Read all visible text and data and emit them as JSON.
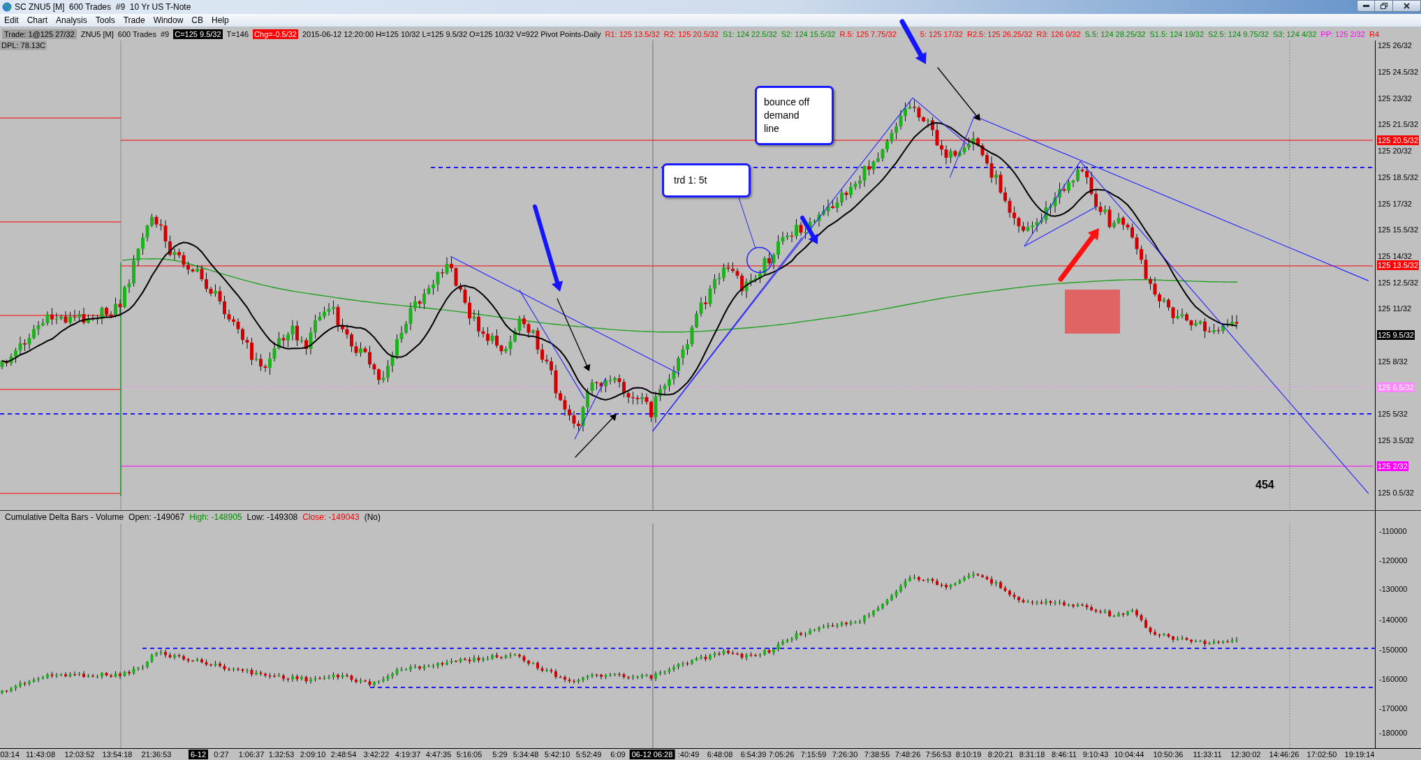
{
  "window": {
    "title": "SC ZNU5 [M]  600 Trades  #9  10 Yr US T-Note"
  },
  "menu": [
    "Edit",
    "Chart",
    "Analysis",
    "Tools",
    "Trade",
    "Window",
    "CB",
    "Help"
  ],
  "info_bar": [
    {
      "text": "Trade: 1@125 27/32",
      "kind": "label",
      "color": "#a0a0a0"
    },
    {
      "text": "ZNU5 [M]  600 Trades  #9",
      "kind": "plain"
    },
    {
      "text": "C=125 9.5/32",
      "kind": "badge",
      "color": "#000000"
    },
    {
      "text": "T=146",
      "kind": "plain"
    },
    {
      "text": "Chg=-0.5/32",
      "kind": "badge",
      "color": "#ff0000"
    },
    {
      "text": "2015-06-12 12:20:00 H=125 10/32 L=125 9.5/32 O=125 10/32 V=922 Pivot Points-Daily",
      "kind": "plain"
    },
    {
      "text": "R1: 125 13.5/32",
      "kind": "text",
      "color": "#ff0000"
    },
    {
      "text": "R2: 125 20.5/32",
      "kind": "text",
      "color": "#ff0000"
    },
    {
      "text": "S1: 124 22.5/32",
      "kind": "text",
      "color": "#009000"
    },
    {
      "text": "S2: 124 15.5/32",
      "kind": "text",
      "color": "#009000"
    },
    {
      "text": "R.5: 125 7.75/32",
      "kind": "text",
      "color": "#ff0000"
    },
    {
      "text": "5: 125 17/32",
      "kind": "text",
      "color": "#ff0000"
    },
    {
      "text": "R2.5: 125 26.25/32",
      "kind": "text",
      "color": "#ff0000"
    },
    {
      "text": "R3: 126 0/32",
      "kind": "text",
      "color": "#ff0000"
    },
    {
      "text": "S.5: 124 28.25/32",
      "kind": "text",
      "color": "#009000"
    },
    {
      "text": "S1.5: 124 19/32",
      "kind": "text",
      "color": "#009000"
    },
    {
      "text": "S2.5: 124 9.75/32",
      "kind": "text",
      "color": "#009000"
    },
    {
      "text": "S3: 124 4/32",
      "kind": "text",
      "color": "#009000"
    },
    {
      "text": "PP: 125 2/32",
      "kind": "text",
      "color": "#ff00ff"
    },
    {
      "text": "R4",
      "kind": "text",
      "color": "#ff0000"
    }
  ],
  "chart": {
    "study_label": "DPL: 78.13C",
    "callouts": [
      "trd 1: 5t",
      "bounce off demand line"
    ],
    "bar_count": "454",
    "price_axis": [
      {
        "text": "125 26/32",
        "kind": "tick"
      },
      {
        "text": "125 24.5/32",
        "kind": "tick"
      },
      {
        "text": "125 23/32",
        "kind": "tick"
      },
      {
        "text": "125 21.5/32",
        "kind": "tick"
      },
      {
        "text": "125 20.5/32",
        "kind": "marker",
        "color": "#ff0000"
      },
      {
        "text": "125 20/32",
        "kind": "tick"
      },
      {
        "text": "125 18.5/32",
        "kind": "tick"
      },
      {
        "text": "125 17/32",
        "kind": "tick"
      },
      {
        "text": "125 15.5/32",
        "kind": "tick"
      },
      {
        "text": "125 14/32",
        "kind": "tick"
      },
      {
        "text": "125 13.5/32",
        "kind": "marker",
        "color": "#ff0000"
      },
      {
        "text": "125 12.5/32",
        "kind": "tick"
      },
      {
        "text": "125 11/32",
        "kind": "tick"
      },
      {
        "text": "125 9.5/32",
        "kind": "marker",
        "color": "#000000"
      },
      {
        "text": "125 8/32",
        "kind": "tick"
      },
      {
        "text": "125 6.5/32",
        "kind": "marker",
        "color": "#ff88ff"
      },
      {
        "text": "125 5/32",
        "kind": "tick"
      },
      {
        "text": "125 3.5/32",
        "kind": "tick"
      },
      {
        "text": "125 2/32",
        "kind": "marker",
        "color": "#ff00ff"
      },
      {
        "text": "125 0.5/32",
        "kind": "tick"
      }
    ]
  },
  "indicator_panel": {
    "header": [
      {
        "text": "Cumulative Delta Bars - Volume",
        "color": "#000000"
      },
      {
        "text": "Open: -149067",
        "color": "#000000"
      },
      {
        "text": "High: -148905",
        "color": "#009000"
      },
      {
        "text": "Low: -149308",
        "color": "#000000"
      },
      {
        "text": "Close: -149043",
        "color": "#ff0000"
      },
      {
        "text": "(No)",
        "color": "#000000"
      }
    ],
    "axis": [
      "-110000",
      "-120000",
      "-130000",
      "-140000",
      "-150000",
      "-160000",
      "-170000",
      "-180000"
    ]
  },
  "time_axis": [
    {
      "text": "03:14",
      "highlighted": false
    },
    {
      "text": "11:43:08",
      "highlighted": false
    },
    {
      "text": "12:03:52",
      "highlighted": false
    },
    {
      "text": "13:54:18",
      "highlighted": false
    },
    {
      "text": "21:36:53",
      "highlighted": false
    },
    {
      "text": "6-12",
      "highlighted": true
    },
    {
      "text": "0:27",
      "highlighted": false
    },
    {
      "text": "1:06:37",
      "highlighted": false
    },
    {
      "text": "1:32:53",
      "highlighted": false
    },
    {
      "text": "2:09:10",
      "highlighted": false
    },
    {
      "text": "2:48:54",
      "highlighted": false
    },
    {
      "text": "3:42:22",
      "highlighted": false
    },
    {
      "text": "4:19:37",
      "highlighted": false
    },
    {
      "text": "4:47:35",
      "highlighted": false
    },
    {
      "text": "5:16:05",
      "highlighted": false
    },
    {
      "text": "5:29",
      "highlighted": false
    },
    {
      "text": "5:34:48",
      "highlighted": false
    },
    {
      "text": "5:42:10",
      "highlighted": false
    },
    {
      "text": "5:52:49",
      "highlighted": false
    },
    {
      "text": "6:09",
      "highlighted": false
    },
    {
      "text": "06-12 06:28",
      "highlighted": true
    },
    {
      "text": ":40:49",
      "highlighted": false
    },
    {
      "text": "6:48:08",
      "highlighted": false
    },
    {
      "text": "6:54:39",
      "highlighted": false
    },
    {
      "text": "7:05:26",
      "highlighted": false
    },
    {
      "text": "7:15:59",
      "highlighted": false
    },
    {
      "text": "7:26:30",
      "highlighted": false
    },
    {
      "text": "7:38:55",
      "highlighted": false
    },
    {
      "text": "7:48:26",
      "highlighted": false
    },
    {
      "text": "7:56:53",
      "highlighted": false
    },
    {
      "text": "8:10:19",
      "highlighted": false
    },
    {
      "text": "8:20:21",
      "highlighted": false
    },
    {
      "text": "8:31:18",
      "highlighted": false
    },
    {
      "text": "8:46:11",
      "highlighted": false
    },
    {
      "text": "9:10:43",
      "highlighted": false
    },
    {
      "text": "10:04:44",
      "highlighted": false
    },
    {
      "text": "10:50:36",
      "highlighted": false
    },
    {
      "text": "11:33:11",
      "highlighted": false
    },
    {
      "text": "12:30:02",
      "highlighted": false
    },
    {
      "text": "14:46:26",
      "highlighted": false
    },
    {
      "text": "17:02:50",
      "highlighted": false
    },
    {
      "text": "19:19:14",
      "highlighted": false
    }
  ]
}
